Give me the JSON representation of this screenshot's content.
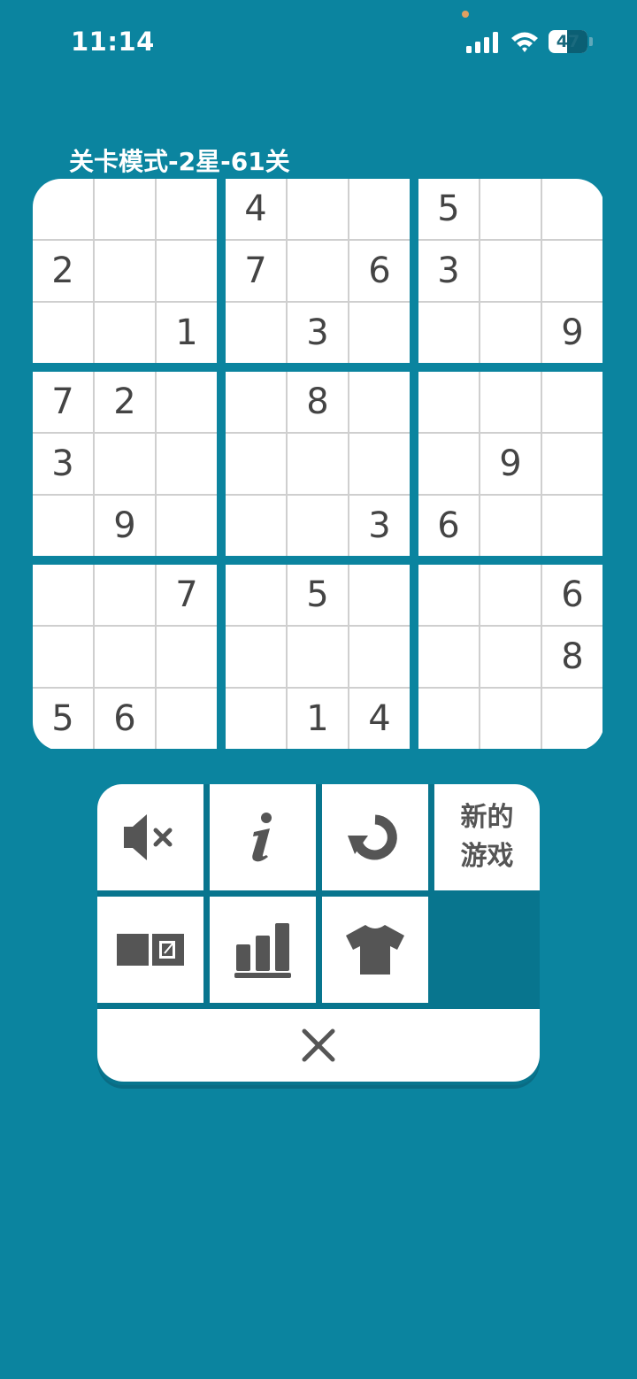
{
  "status_bar": {
    "time": "11:14",
    "battery": "47",
    "battery_level": 0.47,
    "signal_icon": "cellular-signal-icon",
    "wifi_icon": "wifi-icon",
    "notification_dot_color": "#e0a062"
  },
  "title": "关卡模式-2星-61关",
  "colors": {
    "background": "#0b849f",
    "cell": "#ffffff",
    "digit": "#444444",
    "grid_line": "#cfcfcf",
    "icon": "#555555"
  },
  "board": {
    "rows": [
      [
        "",
        "",
        "",
        "4",
        "",
        "",
        "5",
        "",
        ""
      ],
      [
        "2",
        "",
        "",
        "7",
        "",
        "6",
        "3",
        "",
        ""
      ],
      [
        "",
        "",
        "1",
        "",
        "3",
        "",
        "",
        "",
        "9"
      ],
      [
        "7",
        "2",
        "",
        "",
        "8",
        "",
        "",
        "",
        ""
      ],
      [
        "3",
        "",
        "",
        "",
        "",
        "",
        "",
        "9",
        ""
      ],
      [
        "",
        "9",
        "",
        "",
        "",
        "3",
        "6",
        "",
        ""
      ],
      [
        "",
        "",
        "7",
        "",
        "5",
        "",
        "",
        "",
        "6"
      ],
      [
        "",
        "",
        "",
        "",
        "",
        "",
        "",
        "",
        "8"
      ],
      [
        "5",
        "6",
        "",
        "",
        "1",
        "4",
        "",
        "",
        ""
      ]
    ]
  },
  "menu": {
    "mute_icon": "sound-muted-icon",
    "info_icon": "info-icon",
    "restart_icon": "restart-icon",
    "new_game_label": "新的游戏",
    "notes_icon": "notes-icon",
    "stats_icon": "statistics-icon",
    "theme_icon": "tshirt-icon",
    "close_icon": "close-icon"
  }
}
